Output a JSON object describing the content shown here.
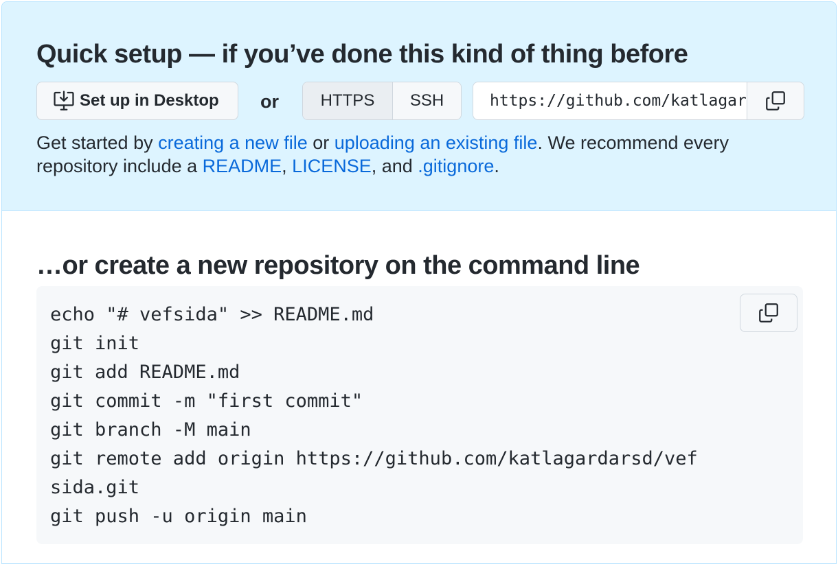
{
  "quick_setup": {
    "title": "Quick setup — if you’ve done this kind of thing before",
    "desktop_button_label": "Set up in Desktop",
    "desktop_icon": "desktop-download-icon",
    "or_label": "or",
    "protocols": [
      {
        "label": "HTTPS",
        "selected": true
      },
      {
        "label": "SSH",
        "selected": false
      }
    ],
    "clone_url": "https://github.com/katlagardarsd/vefsida.git",
    "copy_icon": "copy-icon",
    "intro": {
      "part1": "Get started by ",
      "link_new_file": "creating a new file",
      "part2": " or ",
      "link_upload": "uploading an existing file",
      "part3": ". We recommend every repository include a ",
      "link_readme": "README",
      "part4": ", ",
      "link_license": "LICENSE",
      "part5": ", and ",
      "link_gitignore": ".gitignore",
      "part6": "."
    }
  },
  "command_line": {
    "title": "…or create a new repository on the command line",
    "code_lines": [
      "echo \"# vefsida\" >> README.md",
      "git init",
      "git add README.md",
      "git commit -m \"first commit\"",
      "git branch -M main",
      "git remote add origin https://github.com/katlagardarsd/vef",
      "sida.git",
      "git push -u origin main"
    ],
    "copy_icon": "copy-icon"
  },
  "colors": {
    "quick_setup_bg": "#ddf4ff",
    "link": "#0969da",
    "text": "#24292f",
    "code_bg": "#f6f8fa"
  }
}
